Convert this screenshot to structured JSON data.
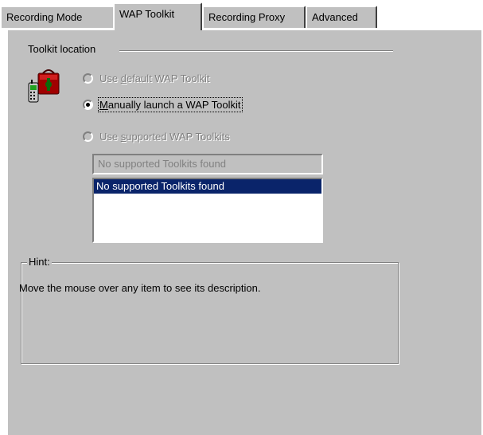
{
  "tabs": [
    {
      "label": "Recording Mode",
      "active": false
    },
    {
      "label": "WAP Toolkit",
      "active": true
    },
    {
      "label": "Recording Proxy",
      "active": false
    },
    {
      "label": "Advanced",
      "active": false
    }
  ],
  "toolkit_location": {
    "group_label": "Toolkit location",
    "icon": "wap-phone-toolbox-icon",
    "options": [
      {
        "label_pre": "Use ",
        "accel": "d",
        "label_post": "efault WAP Toolkit",
        "checked": false,
        "enabled": false
      },
      {
        "label_pre": "",
        "accel": "M",
        "label_post": "anually launch a WAP Toolkit",
        "checked": true,
        "enabled": true
      },
      {
        "label_pre": "Use ",
        "accel": "s",
        "label_post": "upported WAP Toolkits",
        "checked": false,
        "enabled": false
      }
    ],
    "combo_value": "No supported Toolkits found",
    "list_items": [
      "No supported Toolkits found"
    ]
  },
  "hint": {
    "label": "Hint:",
    "text": "Move the mouse over any item to see its description."
  },
  "colors": {
    "dialog_bg": "#c0c0c0",
    "selection_bg": "#0a246a",
    "disabled_text": "#808080"
  }
}
